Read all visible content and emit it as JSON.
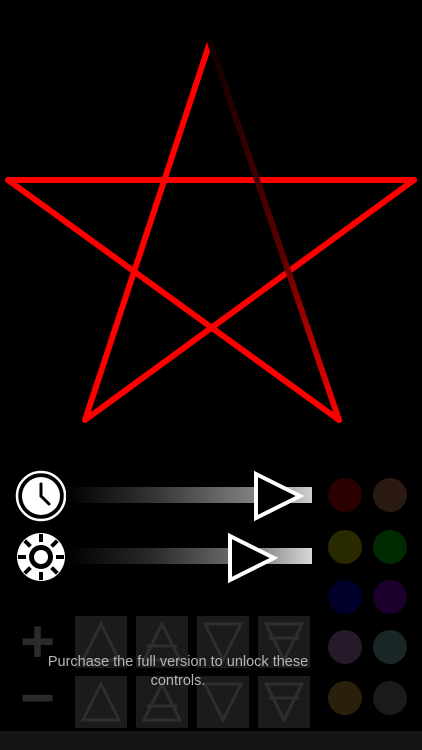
{
  "canvas": {
    "shape": "pentagram",
    "stroke_color": "#ff0000",
    "background": "#000000"
  },
  "controls": {
    "speed": {
      "icon": "clock-icon",
      "level": 0.95
    },
    "brightness": {
      "icon": "sun-icon",
      "level": 0.82
    },
    "play_icon": "play-triangle-icon"
  },
  "colors": {
    "swatches": [
      "#2a0000",
      "#2a1a12",
      "#2a2a00",
      "#002a00",
      "#00002a",
      "#1a002a",
      "#261a2a",
      "#1a2626",
      "#2a1f0a",
      "#1a1a1a"
    ]
  },
  "locked": {
    "plus_label": "+",
    "minus_label": "−",
    "symbols": [
      "air-symbol-icon",
      "earth-symbol-icon",
      "water-symbol-icon",
      "fire-symbol-icon"
    ],
    "message": "Purchase the full version to unlock these controls."
  }
}
